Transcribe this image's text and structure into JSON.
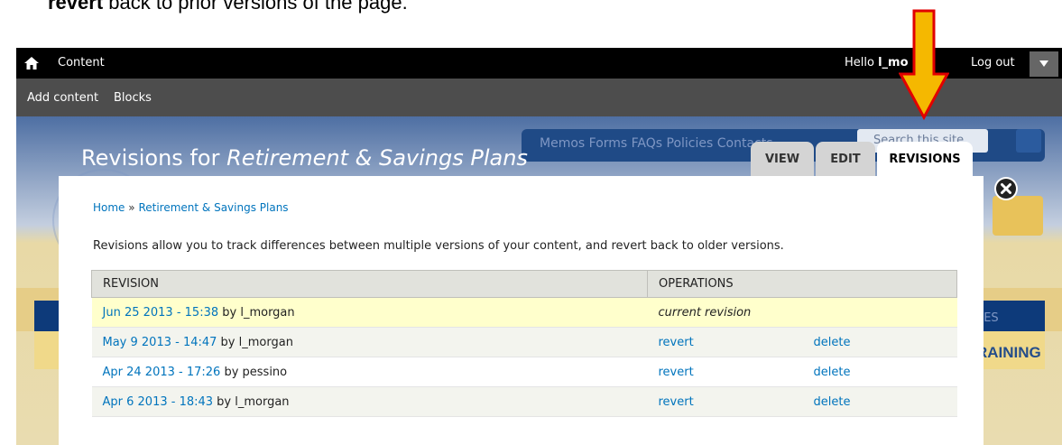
{
  "doc": {
    "bold_word": "revert",
    "rest": " back to prior versions of the page."
  },
  "toolbar": {
    "content_label": "Content",
    "hello_prefix": "Hello ",
    "username": "l_mo",
    "logout_label": "Log out"
  },
  "shortcuts": {
    "add_content": "Add content",
    "blocks": "Blocks"
  },
  "site": {
    "nav_links": "Memos   Forms   FAQs   Policies   Contacts",
    "search_placeholder": "Search this site",
    "training": "RAINING",
    "ees": "EES"
  },
  "page": {
    "title_prefix": "Revisions for ",
    "title_italic": "Retirement & Savings Plans"
  },
  "tabs": [
    {
      "label": "VIEW"
    },
    {
      "label": "EDIT"
    },
    {
      "label": "REVISIONS",
      "active": true
    }
  ],
  "breadcrumb": {
    "home": "Home",
    "separator": "»",
    "current": "Retirement & Savings Plans"
  },
  "help_text": "Revisions allow you to track differences between multiple versions of your content, and revert back to older versions.",
  "table": {
    "headers": {
      "revision": "REVISION",
      "operations": "OPERATIONS"
    },
    "rows": [
      {
        "date": "Jun 25 2013 - 15:38",
        "by": " by l_morgan",
        "status": "current revision"
      },
      {
        "date": "May 9 2013 - 14:47",
        "by": " by l_morgan",
        "revert": "revert",
        "delete": "delete"
      },
      {
        "date": "Apr 24 2013 - 17:26",
        "by": " by pessino",
        "revert": "revert",
        "delete": "delete"
      },
      {
        "date": "Apr 6 2013 - 18:43",
        "by": " by l_morgan",
        "revert": "revert",
        "delete": "delete"
      }
    ]
  },
  "colors": {
    "toolbar": "#000000",
    "shortcuts": "#4d4d4d",
    "link": "#0074bd",
    "current_row": "#ffffcc",
    "arrow_fill": "#f5b800",
    "arrow_stroke": "#e10000"
  },
  "icons": {
    "home": "home-icon",
    "dropdown": "chevron-down-icon",
    "close": "close-icon",
    "arrow": "down-arrow-icon"
  }
}
